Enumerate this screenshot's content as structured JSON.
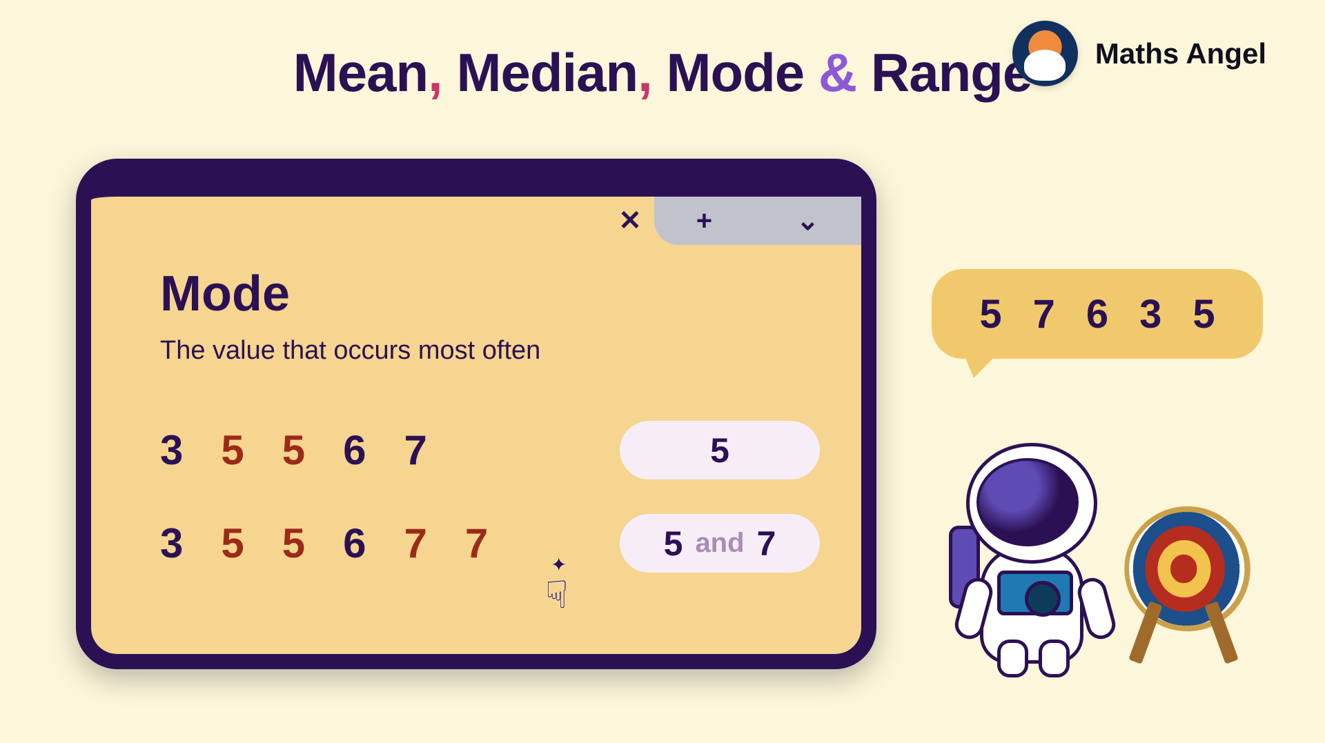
{
  "brand": "Maths Angel",
  "title": {
    "w1": "Mean",
    "w2": "Median",
    "w3": "Mode",
    "amp": "&",
    "w4": "Range",
    "sep": ","
  },
  "notch": {
    "close": "✕",
    "plus": "+",
    "chev": "⌄"
  },
  "topic": {
    "name": "Mode",
    "desc": "The value that occurs most often"
  },
  "seq1": {
    "n": [
      "3",
      "5",
      "5",
      "6",
      "7"
    ],
    "hl": [
      false,
      true,
      true,
      false,
      false
    ],
    "ans": "5"
  },
  "seq2": {
    "n": [
      "3",
      "5",
      "5",
      "6",
      "7",
      "7"
    ],
    "hl": [
      false,
      true,
      true,
      false,
      true,
      true
    ],
    "ansA": "5",
    "and": "and",
    "ansB": "7"
  },
  "bubble": [
    "5",
    "7",
    "6",
    "3",
    "5"
  ],
  "cursor": "☟"
}
